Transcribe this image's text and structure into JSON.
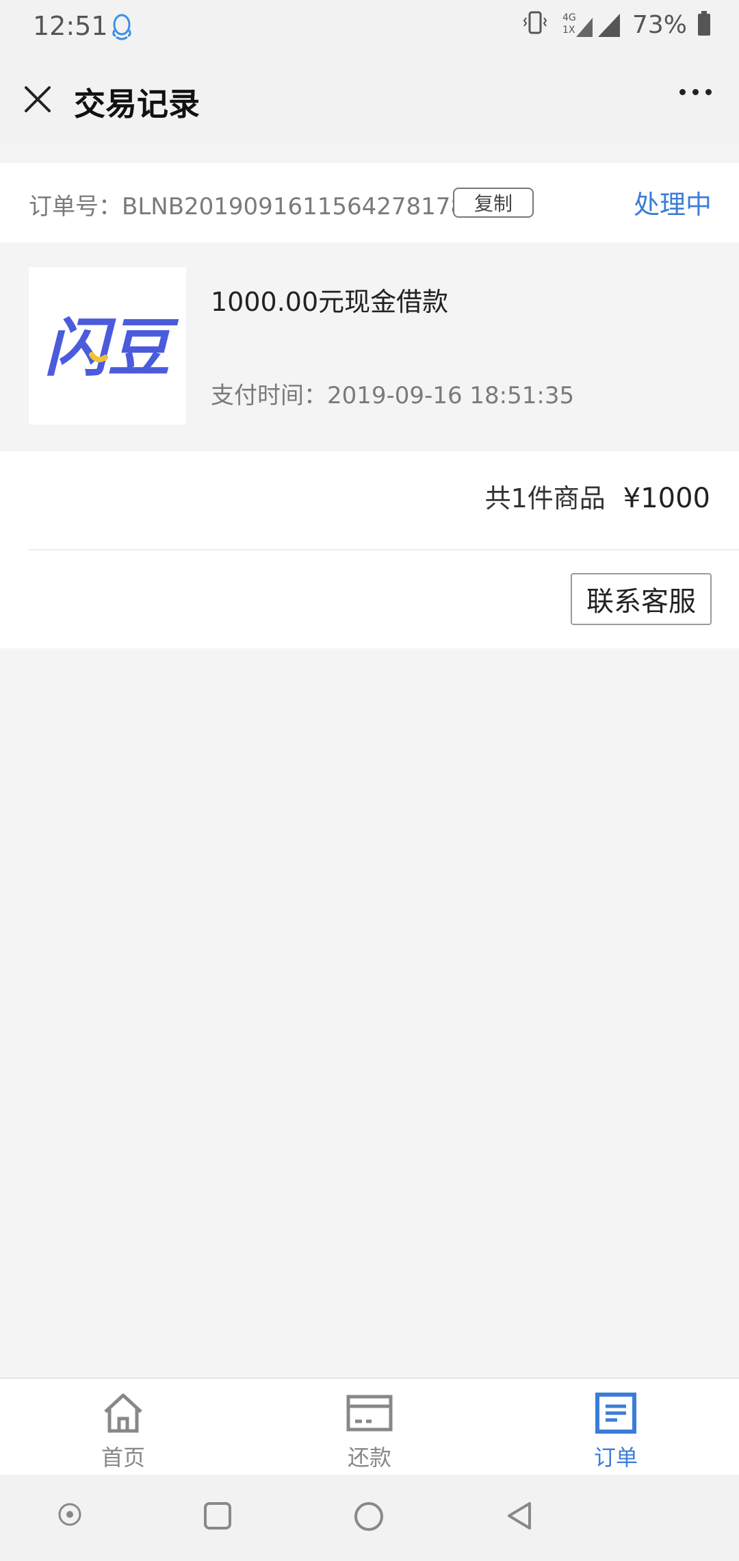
{
  "status_bar": {
    "time": "12:51",
    "battery": "73%",
    "network_labels": [
      "4G",
      "1X"
    ],
    "icons": [
      "qq-icon",
      "vibrate-icon",
      "signal-icon",
      "battery-icon"
    ]
  },
  "title_bar": {
    "title": "交易记录",
    "close_icon": "close-icon",
    "more_icon": "more-icon"
  },
  "order": {
    "order_no_label": "订单号：BLNB20190916115642781​78",
    "copy_label": "复制",
    "status": "处理中",
    "status_color": "#3b7dd8"
  },
  "product": {
    "logo_text": "闪豆",
    "logo_color": "#4a5bdc",
    "logo_accent": "#f2c230",
    "name": "1000.00元现金借款",
    "pay_time": "支付时间：2019-09-16 18:51:35"
  },
  "summary": {
    "count_text": "共1件商品",
    "total": "¥1000",
    "contact_label": "联系客服"
  },
  "tabs": [
    {
      "label": "首页",
      "icon": "home-icon",
      "active": false
    },
    {
      "label": "还款",
      "icon": "repay-icon",
      "active": false
    },
    {
      "label": "订单",
      "icon": "order-icon",
      "active": true
    }
  ],
  "nav_bar": {
    "icons": [
      "assistant-icon",
      "recents-icon",
      "home-circle-icon",
      "back-icon"
    ]
  },
  "colors": {
    "accent": "#3b7dd8",
    "background": "#f4f4f4"
  }
}
